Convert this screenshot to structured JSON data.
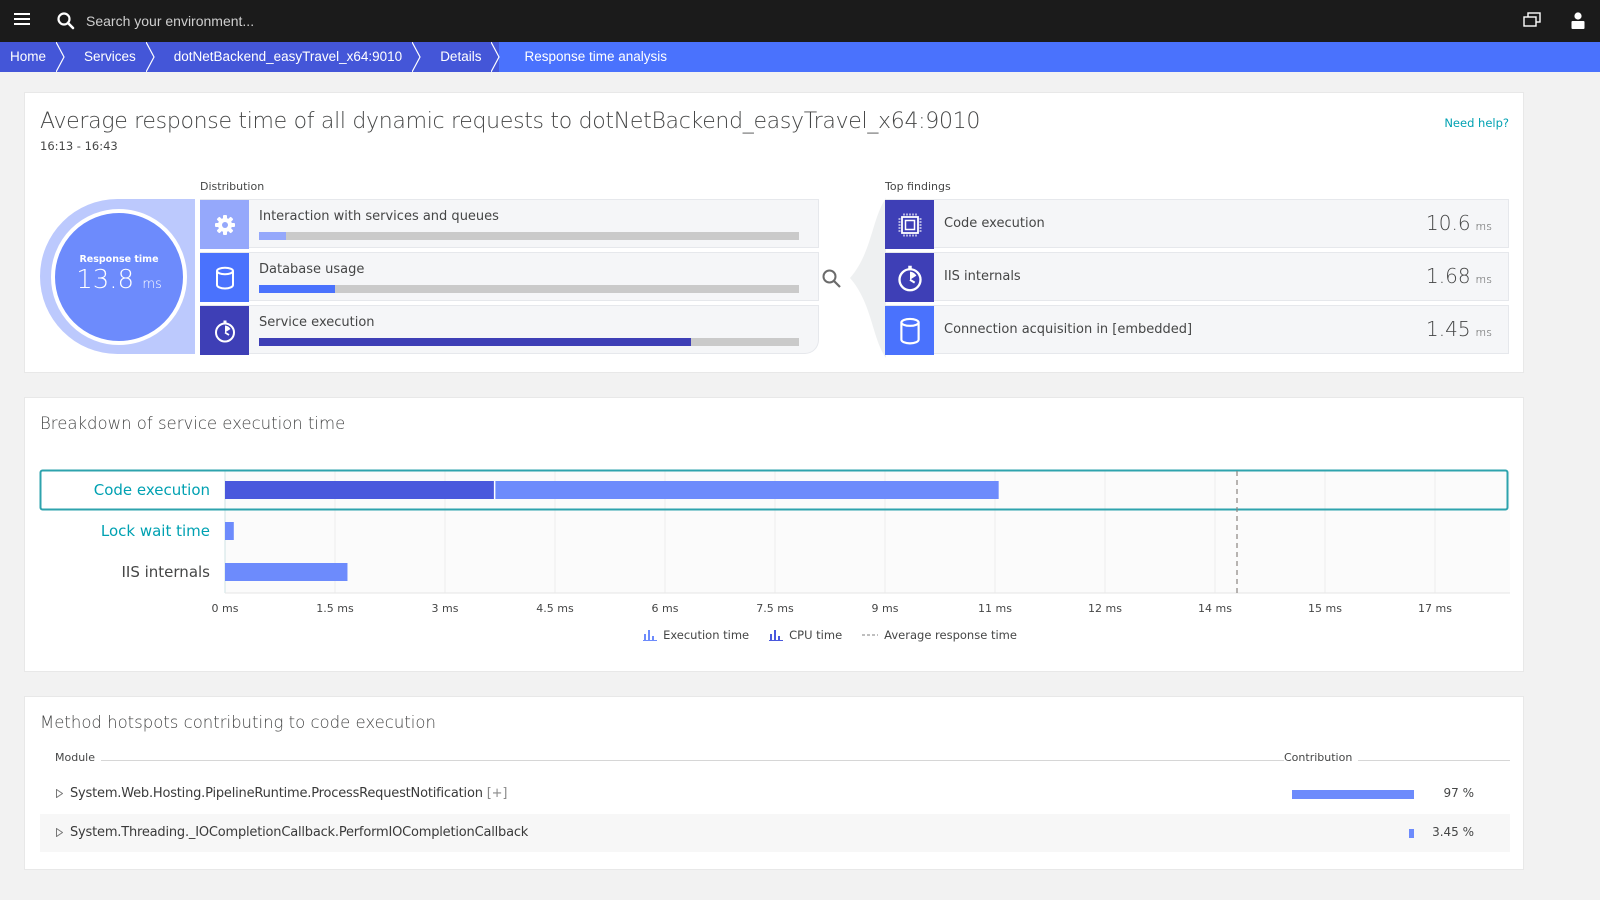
{
  "topbar": {
    "search_placeholder": "Search your environment...",
    "icons": [
      "menu-icon",
      "search-icon",
      "chat-windows-icon",
      "user-icon"
    ]
  },
  "breadcrumb": [
    {
      "label": "Home"
    },
    {
      "label": "Services"
    },
    {
      "label": "dotNetBackend_easyTravel_x64:9010"
    },
    {
      "label": "Details"
    },
    {
      "label": "Response time analysis",
      "active": true
    }
  ],
  "overview": {
    "title": "Average response time of all dynamic requests to dotNetBackend_easyTravel_x64:9010",
    "timeframe": "16:13 - 16:43",
    "need_help": "Need help?",
    "response_time": {
      "label": "Response time",
      "value": "13.8",
      "unit": "ms"
    },
    "distribution_label": "Distribution",
    "distribution": [
      {
        "name": "Interaction with services and queues",
        "icon": "gear-icon",
        "fraction": 0.05,
        "color": "#95a8fb"
      },
      {
        "name": "Database usage",
        "icon": "database-icon",
        "fraction": 0.14,
        "color": "#4a72fd"
      },
      {
        "name": "Service execution",
        "icon": "stopwatch-icon",
        "fraction": 0.8,
        "color": "#3e3fb6"
      }
    ],
    "top_findings_label": "Top findings",
    "top_findings": [
      {
        "name": "Code execution",
        "icon": "cpu-chip-icon",
        "value": "10.6",
        "unit": "ms",
        "color": "#3e3fb6"
      },
      {
        "name": "IIS internals",
        "icon": "stopwatch-icon",
        "value": "1.68",
        "unit": "ms",
        "color": "#3e3fb6"
      },
      {
        "name": "Connection acquisition in [embedded]",
        "icon": "database-icon",
        "value": "1.45",
        "unit": "ms",
        "color": "#4a72fd"
      }
    ]
  },
  "breakdown": {
    "title": "Breakdown of service execution time"
  },
  "chart_data": {
    "type": "bar",
    "orientation": "horizontal",
    "title": "Breakdown of service execution time",
    "categories": [
      "Code execution",
      "Lock wait time",
      "IIS internals"
    ],
    "selected_category": "Code execution",
    "series": [
      {
        "name": "Execution time",
        "values": [
          10.55,
          0.12,
          1.67
        ],
        "color": "#6d8bfc"
      },
      {
        "name": "CPU time",
        "values": [
          3.67,
          null,
          null
        ],
        "color": "#4a58dd"
      }
    ],
    "reference_lines": [
      {
        "name": "Average response time",
        "value": 13.8,
        "style": "dashed"
      }
    ],
    "xlim": [
      0,
      17.25
    ],
    "x_ticks": [
      {
        "value": 0,
        "label": "0 ms"
      },
      {
        "value": 1.5,
        "label": "1.5 ms"
      },
      {
        "value": 3,
        "label": "3 ms"
      },
      {
        "value": 4.5,
        "label": "4.5 ms"
      },
      {
        "value": 6,
        "label": "6 ms"
      },
      {
        "value": 7.5,
        "label": "7.5 ms"
      },
      {
        "value": 9,
        "label": "9 ms"
      },
      {
        "value": 10.5,
        "label": "11 ms"
      },
      {
        "value": 12,
        "label": "12 ms"
      },
      {
        "value": 13.5,
        "label": "14 ms"
      },
      {
        "value": 15,
        "label": "15 ms"
      },
      {
        "value": 16.5,
        "label": "17 ms"
      }
    ],
    "legend": [
      "Execution time",
      "CPU time",
      "Average response time"
    ],
    "legend_position": "bottom-center",
    "grid": true
  },
  "hotspots": {
    "title": "Method hotspots contributing to code execution",
    "columns": {
      "module": "Module",
      "contribution": "Contribution"
    },
    "rows": [
      {
        "name": "System.Web.Hosting.PipelineRuntime.ProcessRequestNotification",
        "expand": "[+]",
        "contribution": 0.97,
        "contribution_label": "97 %"
      },
      {
        "name": "System.Threading._IOCompletionCallback.PerformIOCompletionCallback",
        "expand": "",
        "contribution": 0.0345,
        "contribution_label": "3.45 %"
      }
    ]
  }
}
